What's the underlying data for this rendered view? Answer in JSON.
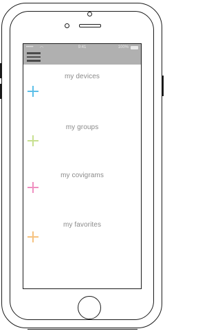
{
  "status_bar": {
    "signal": "•••••",
    "time": "9:41",
    "battery": "100%"
  },
  "menu": {
    "items": [
      {
        "label": "my devices",
        "icon": "plus-icon",
        "color": "#5bbfe8"
      },
      {
        "label": "my groups",
        "icon": "plus-icon",
        "color": "#c7df8f"
      },
      {
        "label": "my covigrams",
        "icon": "plus-icon",
        "color": "#ef8fc0"
      },
      {
        "label": "my favorites",
        "icon": "plus-icon",
        "color": "#f6c27f"
      }
    ]
  }
}
